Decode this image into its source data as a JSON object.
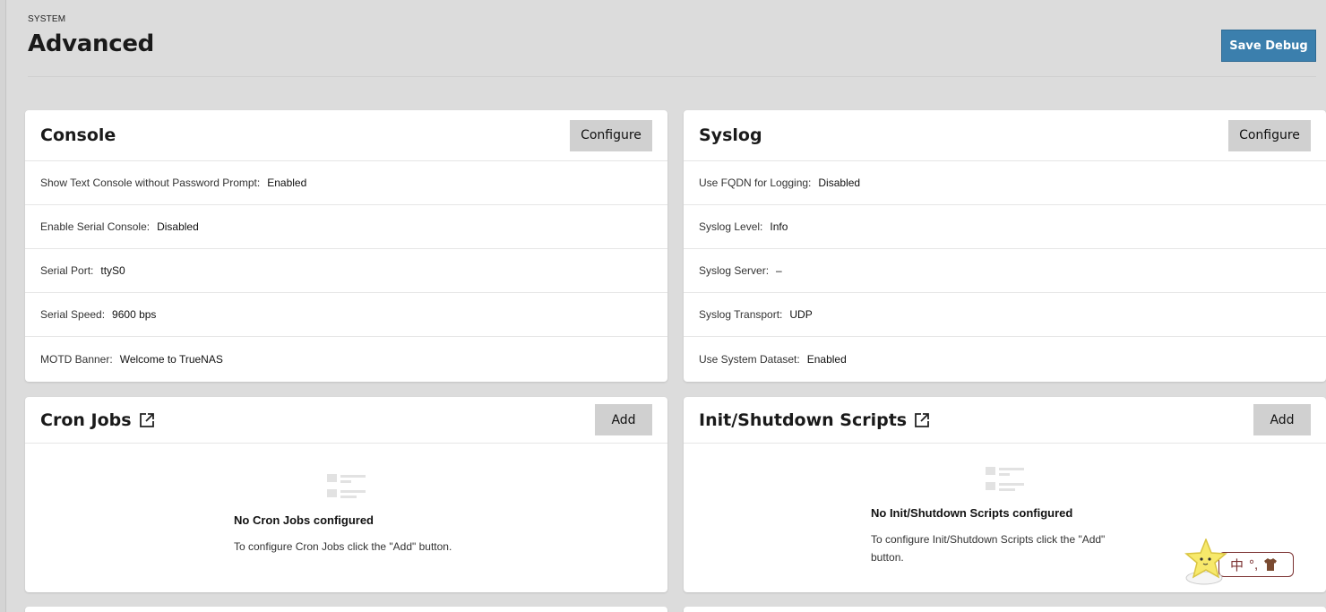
{
  "header": {
    "breadcrumb": "SYSTEM",
    "title": "Advanced",
    "save_debug_label": "Save Debug"
  },
  "console": {
    "title": "Console",
    "button": "Configure",
    "rows": [
      {
        "label": "Show Text Console without Password Prompt:",
        "value": "Enabled"
      },
      {
        "label": "Enable Serial Console:",
        "value": "Disabled"
      },
      {
        "label": "Serial Port:",
        "value": "ttyS0"
      },
      {
        "label": "Serial Speed:",
        "value": "9600 bps"
      },
      {
        "label": "MOTD Banner:",
        "value": "Welcome to TrueNAS"
      }
    ]
  },
  "syslog": {
    "title": "Syslog",
    "button": "Configure",
    "rows": [
      {
        "label": "Use FQDN for Logging:",
        "value": "Disabled"
      },
      {
        "label": "Syslog Level:",
        "value": "Info"
      },
      {
        "label": "Syslog Server:",
        "value": "–"
      },
      {
        "label": "Syslog Transport:",
        "value": "UDP"
      },
      {
        "label": "Use System Dataset:",
        "value": "Enabled"
      }
    ]
  },
  "cron": {
    "title": "Cron Jobs",
    "button": "Add",
    "empty_title": "No Cron Jobs configured",
    "empty_desc": "To configure Cron Jobs click the \"Add\" button."
  },
  "init": {
    "title": "Init/Shutdown Scripts",
    "button": "Add",
    "empty_title": "No Init/Shutdown Scripts configured",
    "empty_desc": "To configure Init/Shutdown Scripts click the \"Add\" button."
  },
  "ime": {
    "char": "中",
    "symbols": "°,"
  },
  "colors": {
    "accent": "#3b7fad",
    "page_bg": "#dcdcdc",
    "button_gray": "#d0d0d0"
  }
}
